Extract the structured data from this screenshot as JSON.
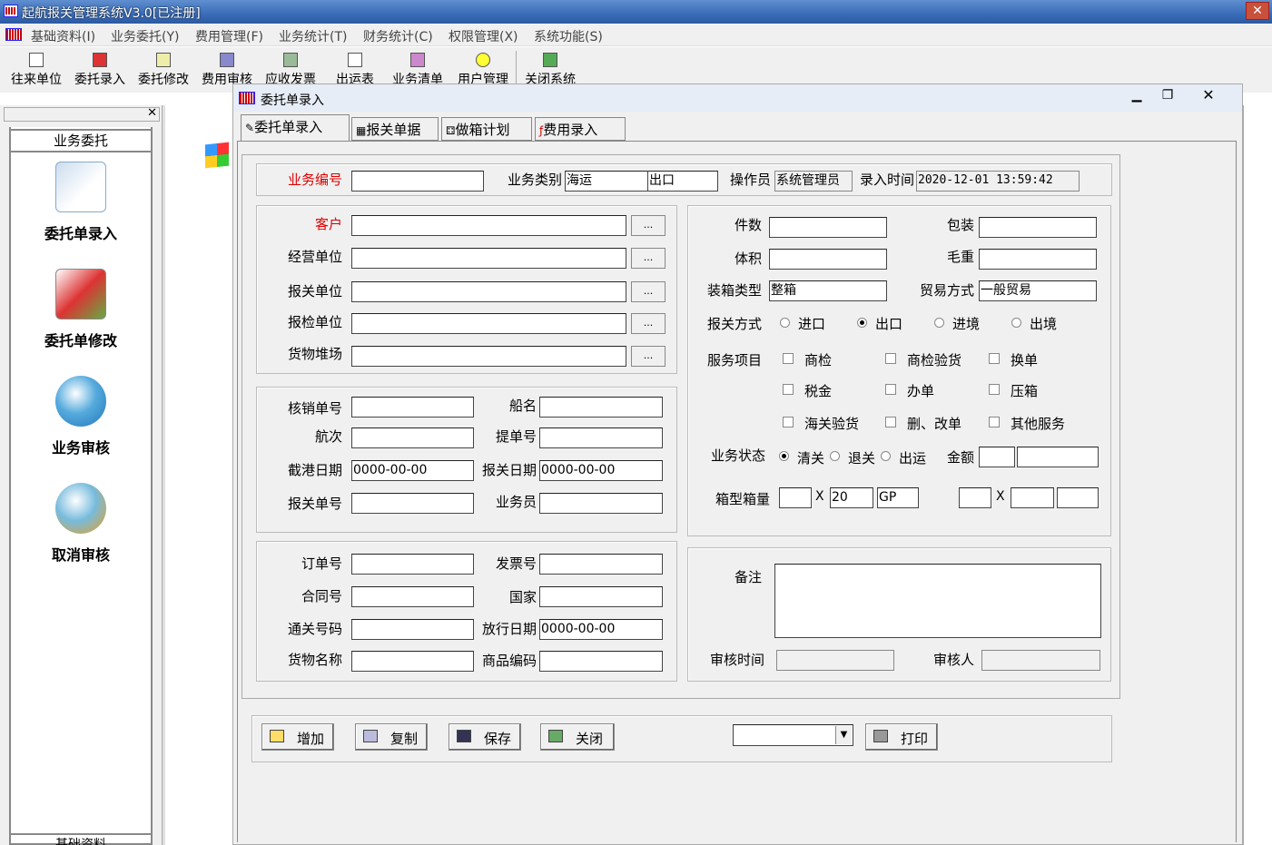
{
  "app": {
    "title": "起航报关管理系统V3.0[已注册]"
  },
  "menu": [
    "基础资料(I)",
    "业务委托(Y)",
    "费用管理(F)",
    "业务统计(T)",
    "财务统计(C)",
    "权限管理(X)",
    "系统功能(S)"
  ],
  "toolbar": [
    "往来单位",
    "委托录入",
    "委托修改",
    "费用审核",
    "应收发票",
    "出运表",
    "业务清单",
    "用户管理",
    "关闭系统"
  ],
  "sidebar": {
    "section": "业务委托",
    "items": [
      "委托单录入",
      "委托单修改",
      "业务审核",
      "取消审核"
    ],
    "bottom": "基础资料"
  },
  "window": {
    "title": "委托单录入"
  },
  "tabs": [
    "委托单录入",
    "报关单据",
    "做箱计划",
    "费用录入"
  ],
  "header": {
    "biz_no_label": "业务编号",
    "biz_no": "",
    "type_label": "业务类别",
    "type1": "海运",
    "type2": "出口",
    "operator_label": "操作员",
    "operator": "系统管理员",
    "entry_time_label": "录入时间",
    "entry_time": "2020-12-01 13:59:42"
  },
  "parties": {
    "customer": "客户",
    "operator_unit": "经营单位",
    "customs_unit": "报关单位",
    "inspection_unit": "报检单位",
    "yard": "货物堆场",
    "dots": "..."
  },
  "shipping": {
    "verify_no": "核销单号",
    "ship_name": "船名",
    "voyage": "航次",
    "bl_no": "提单号",
    "cutoff_label": "截港日期",
    "cutoff": "0000-00-00",
    "declare_date_label": "报关日期",
    "declare_date": "0000-00-00",
    "declare_no": "报关单号",
    "salesman": "业务员"
  },
  "order": {
    "order_no": "订单号",
    "invoice_no": "发票号",
    "contract_no": "合同号",
    "country": "国家",
    "clearance_no": "通关号码",
    "release_date_label": "放行日期",
    "release_date": "0000-00-00",
    "goods_name": "货物名称",
    "goods_code": "商品编码"
  },
  "cargo": {
    "pieces": "件数",
    "packing": "包装",
    "volume": "体积",
    "gross": "毛重",
    "container_type_label": "装箱类型",
    "container_type": "整箱",
    "trade_label": "贸易方式",
    "trade": "一般贸易",
    "declare_mode": "报关方式",
    "modes": [
      "进口",
      "出口",
      "进境",
      "出境"
    ],
    "service": "服务项目",
    "services": [
      "商检",
      "商检验货",
      "换单",
      "税金",
      "办单",
      "压箱",
      "海关验货",
      "删、改单",
      "其他服务"
    ],
    "status_label": "业务状态",
    "statuses": [
      "清关",
      "退关",
      "出运"
    ],
    "amount_label": "金额",
    "box_label": "箱型箱量",
    "x": "X",
    "size": "20",
    "gp": "GP"
  },
  "remarks": {
    "label": "备注",
    "audit_time": "审核时间",
    "auditor": "审核人"
  },
  "buttons": [
    "增加",
    "复制",
    "保存",
    "关闭",
    "打印"
  ]
}
